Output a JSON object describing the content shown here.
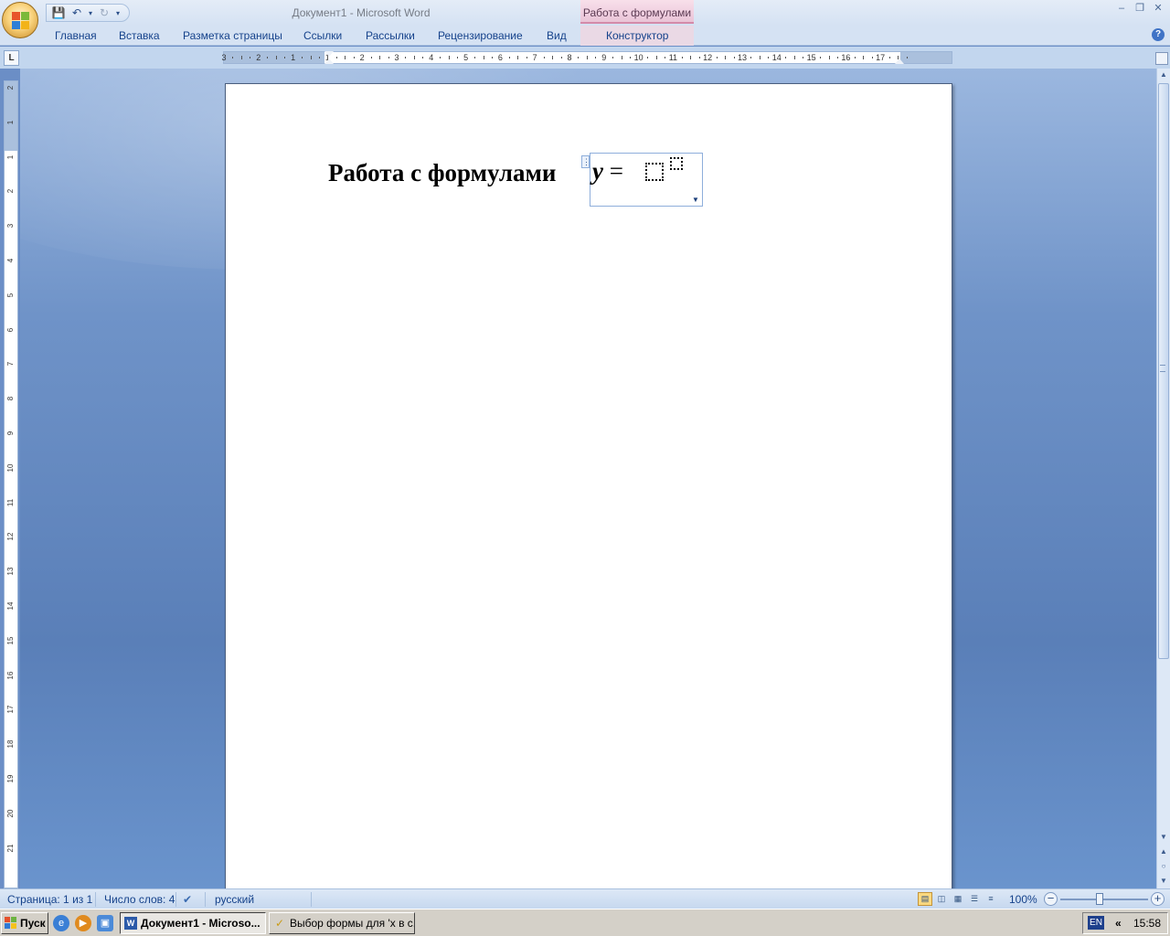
{
  "window": {
    "title": "Документ1 - Microsoft Word",
    "contextual_header": "Работа с формулами"
  },
  "quick_access": [
    "save-icon",
    "undo-icon",
    "redo-icon",
    "customize-icon"
  ],
  "ribbon": {
    "tabs": [
      "Главная",
      "Вставка",
      "Разметка страницы",
      "Ссылки",
      "Рассылки",
      "Рецензирование",
      "Вид"
    ],
    "contextual_tab": "Конструктор"
  },
  "ruler": {
    "horizontal_labels": [
      "3",
      "2",
      "1",
      "1",
      "2",
      "3",
      "4",
      "5",
      "6",
      "7",
      "8",
      "9",
      "10",
      "11",
      "12",
      "13",
      "14",
      "15",
      "16",
      "17"
    ],
    "vertical_labels": [
      "2",
      "1",
      "1",
      "2",
      "3",
      "4",
      "5",
      "6",
      "7",
      "8",
      "9",
      "10",
      "11",
      "12",
      "13",
      "14",
      "15",
      "16",
      "17",
      "18",
      "19",
      "20",
      "21"
    ]
  },
  "document": {
    "heading": "Работа с формулами",
    "equation": {
      "variable": "y",
      "operator": "="
    }
  },
  "status_bar": {
    "page": "Страница: 1 из 1",
    "words": "Число слов: 4",
    "language": "русский",
    "zoom": "100%",
    "zoom_level": 1.0
  },
  "taskbar": {
    "start": "Пуск",
    "tasks": [
      "Документ1 - Microso...",
      "Выбор формы для 'x в с..."
    ],
    "lang": "EN",
    "tray_arrow": "«",
    "clock": "15:58"
  },
  "colors": {
    "ribbon_bg": "#d5e2f3",
    "contextual_accent": "#d48aa9",
    "workspace": "#6b8ec6",
    "text_blue": "#15428b"
  }
}
